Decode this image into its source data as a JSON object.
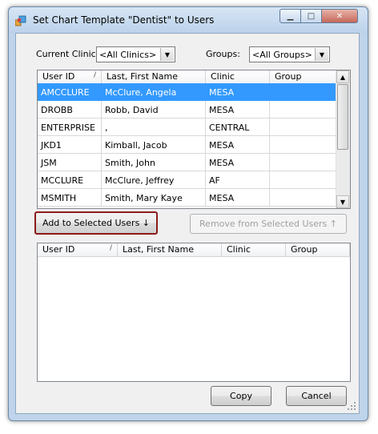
{
  "window": {
    "title": "Set Chart Template \"Dentist\" to Users",
    "minimize_glyph": "▁",
    "maximize_glyph": "□",
    "close_glyph": "✕"
  },
  "filters": {
    "clinic_label": "Current Clinic:",
    "clinic_value": "<All Clinics>",
    "groups_label": "Groups:",
    "groups_value": "<All Groups>"
  },
  "available_users": {
    "columns": [
      "User ID",
      "Last, First Name",
      "Clinic",
      "Group"
    ],
    "sort_glyph": "/",
    "selected_row": 0,
    "rows": [
      [
        "AMCCLURE",
        "McClure, Angela",
        "MESA",
        ""
      ],
      [
        "DROBB",
        "Robb, David",
        "MESA",
        ""
      ],
      [
        "ENTERPRISE",
        ",",
        "CENTRAL",
        ""
      ],
      [
        "JKD1",
        "Kimball, Jacob",
        "MESA",
        ""
      ],
      [
        "JSM",
        "Smith, John",
        "MESA",
        ""
      ],
      [
        "MCCLURE",
        "McClure, Jeffrey",
        "AF",
        ""
      ],
      [
        "MSMITH",
        "Smith, Mary Kaye",
        "MESA",
        ""
      ]
    ]
  },
  "actions": {
    "add_label": "Add to Selected Users ↓",
    "remove_label": "Remove from Selected Users ↑"
  },
  "selected_users": {
    "columns": [
      "User ID",
      "Last, First Name",
      "Clinic",
      "Group"
    ],
    "sort_glyph": "/",
    "rows": []
  },
  "footer": {
    "copy_label": "Copy",
    "cancel_label": "Cancel"
  }
}
